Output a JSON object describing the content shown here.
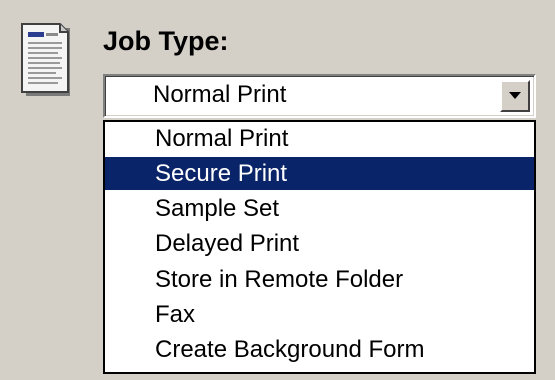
{
  "job_type": {
    "label": "Job Type:",
    "icon": "document-icon",
    "selected_value": "Normal Print",
    "dropdown_icon": "chevron-down-icon",
    "options": [
      "Normal Print",
      "Secure Print",
      "Sample Set",
      "Delayed Print",
      "Store in Remote Folder",
      "Fax",
      "Create Background Form"
    ],
    "highlighted_option": "Secure Print"
  },
  "colors": {
    "background": "#d4d0c8",
    "highlight": "#0a246a",
    "highlight_text": "#ffffff"
  }
}
